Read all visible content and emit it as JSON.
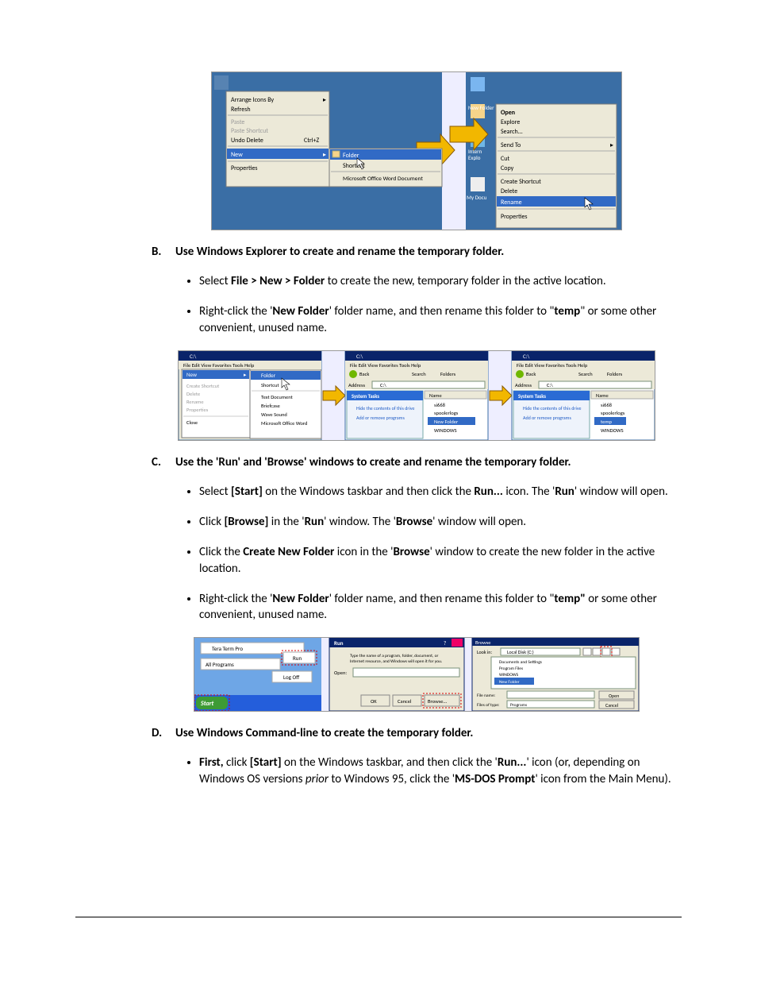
{
  "figA": {
    "left_menu": {
      "items": [
        {
          "label": "Arrange Icons By",
          "sub": true
        },
        {
          "label": "Refresh"
        },
        {
          "label": "Paste",
          "disabled": true
        },
        {
          "label": "Paste Shortcut",
          "disabled": true
        },
        {
          "label": "Undo Delete",
          "accel": "Ctrl+Z"
        },
        {
          "label": "New",
          "sub": true,
          "hl": true
        },
        {
          "label": "Properties"
        }
      ],
      "sub_items": [
        {
          "label": "Folder",
          "icon": "folder-icon"
        },
        {
          "label": "Shortcut",
          "icon": "shortcut-icon"
        },
        {
          "label": "Microsoft Office Word Document",
          "icon": "word-icon"
        }
      ]
    },
    "right_menu": {
      "caption_top": "New Folder",
      "desktop_icons": [
        "Intern",
        "Explo",
        "My Docu"
      ],
      "items": [
        {
          "label": "Open",
          "bold": true
        },
        {
          "label": "Explore"
        },
        {
          "label": "Search..."
        },
        {
          "label": "Send To",
          "sub": true
        },
        {
          "label": "Cut"
        },
        {
          "label": "Copy"
        },
        {
          "label": "Create Shortcut"
        },
        {
          "label": "Delete"
        },
        {
          "label": "Rename",
          "hl": true
        },
        {
          "label": "Properties"
        }
      ]
    }
  },
  "sectionB": {
    "letter": "B.",
    "title": "Use Windows Explorer to create and rename the temporary folder.",
    "bullets": [
      {
        "pre": "Select ",
        "b1": "File > New > Folder",
        "post": " to create the new, temporary folder in the active location."
      },
      {
        "pre": "Right-click the '",
        "b1": "New Folder",
        "mid1": "' folder name, and then rename this folder to \"",
        "b2": "temp",
        "post": "\" or some other convenient, unused name."
      }
    ]
  },
  "figB": {
    "title": "C:\\",
    "menu": [
      "File",
      "Edit",
      "View",
      "Favorites",
      "Tools",
      "Help"
    ],
    "file_menu": {
      "new_label": "New",
      "sub": [
        "Folder",
        "Shortcut",
        "Text Document",
        "Briefcase",
        "Wave Sound",
        "Microsoft Office Word"
      ],
      "rest": [
        "Create Shortcut",
        "Delete",
        "Rename",
        "Properties",
        "Close"
      ]
    },
    "toolbar": {
      "back": "Back",
      "search": "Search",
      "folders": "Folders"
    },
    "address_label": "Address",
    "address_value": "C:\\",
    "tasks_header": "System Tasks",
    "tasks": [
      "Hide the contents of this drive",
      "Add or remove programs"
    ],
    "name_header": "Name",
    "files2": [
      "si668",
      "spoolerlogs",
      "New Folder",
      "WINDOWS"
    ],
    "files3": [
      "si668",
      "spoolerlogs",
      "temp",
      "WINDOWS"
    ]
  },
  "sectionC": {
    "letter": "C.",
    "title": "Use the 'Run' and 'Browse' windows to create and rename the temporary folder.",
    "bullets": [
      {
        "text_parts": [
          "Select ",
          "[Start]",
          " on the Windows taskbar and then click the ",
          "Run...",
          " icon. The '",
          "Run",
          "' window will open."
        ],
        "bold_idx": [
          1,
          3,
          5
        ]
      },
      {
        "text_parts": [
          "Click ",
          "[Browse]",
          " in the '",
          "Run",
          "' window. The '",
          "Browse",
          "' window will open."
        ],
        "bold_idx": [
          1,
          3,
          5
        ]
      },
      {
        "text_parts": [
          "Click the ",
          "Create New Folder",
          " icon in the '",
          "Browse",
          "' window to create the new folder in the active location."
        ],
        "bold_idx": [
          1,
          3
        ]
      },
      {
        "text_parts": [
          "Right-click the '",
          "New Folder",
          "' folder name, and then rename this folder to \"",
          "temp\"",
          " or some other convenient, unused name."
        ],
        "bold_idx": [
          1,
          3
        ]
      }
    ]
  },
  "figC": {
    "start": {
      "tera": "Tera Term Pro",
      "allprog": "All Programs",
      "run": "Run",
      "logoff": "Log Off",
      "start": "Start"
    },
    "run": {
      "title": "Run",
      "msg": "Type the name of a program, folder, document, or Internet resource, and Windows will open it for you.",
      "open": "Open:",
      "ok": "OK",
      "cancel": "Cancel",
      "browse": "Browse..."
    },
    "browse": {
      "title": "Browse",
      "lookin": "Look in:",
      "drive": "Local Disk (C:)",
      "items": [
        "Documents and Settings",
        "Program Files",
        "WINDOWS",
        "New Folder"
      ],
      "filename": "File name:",
      "filetype": "Files of type:",
      "filetype_v": "Programs",
      "open": "Open",
      "cancel": "Cancel"
    }
  },
  "sectionD": {
    "letter": "D.",
    "title": "Use Windows Command-line to create the temporary folder.",
    "bullet": {
      "parts": [
        "First,",
        " click ",
        "[Start]",
        " on the Windows taskbar, and then click the '",
        "Run...",
        "' icon (or, depending on Windows OS versions ",
        "prior",
        " to Windows 95, click the '",
        "MS-DOS Prompt",
        "' icon from the Main Menu)."
      ],
      "bold_idx": [
        0,
        2,
        4,
        8
      ],
      "ital_idx": [
        6
      ]
    }
  }
}
